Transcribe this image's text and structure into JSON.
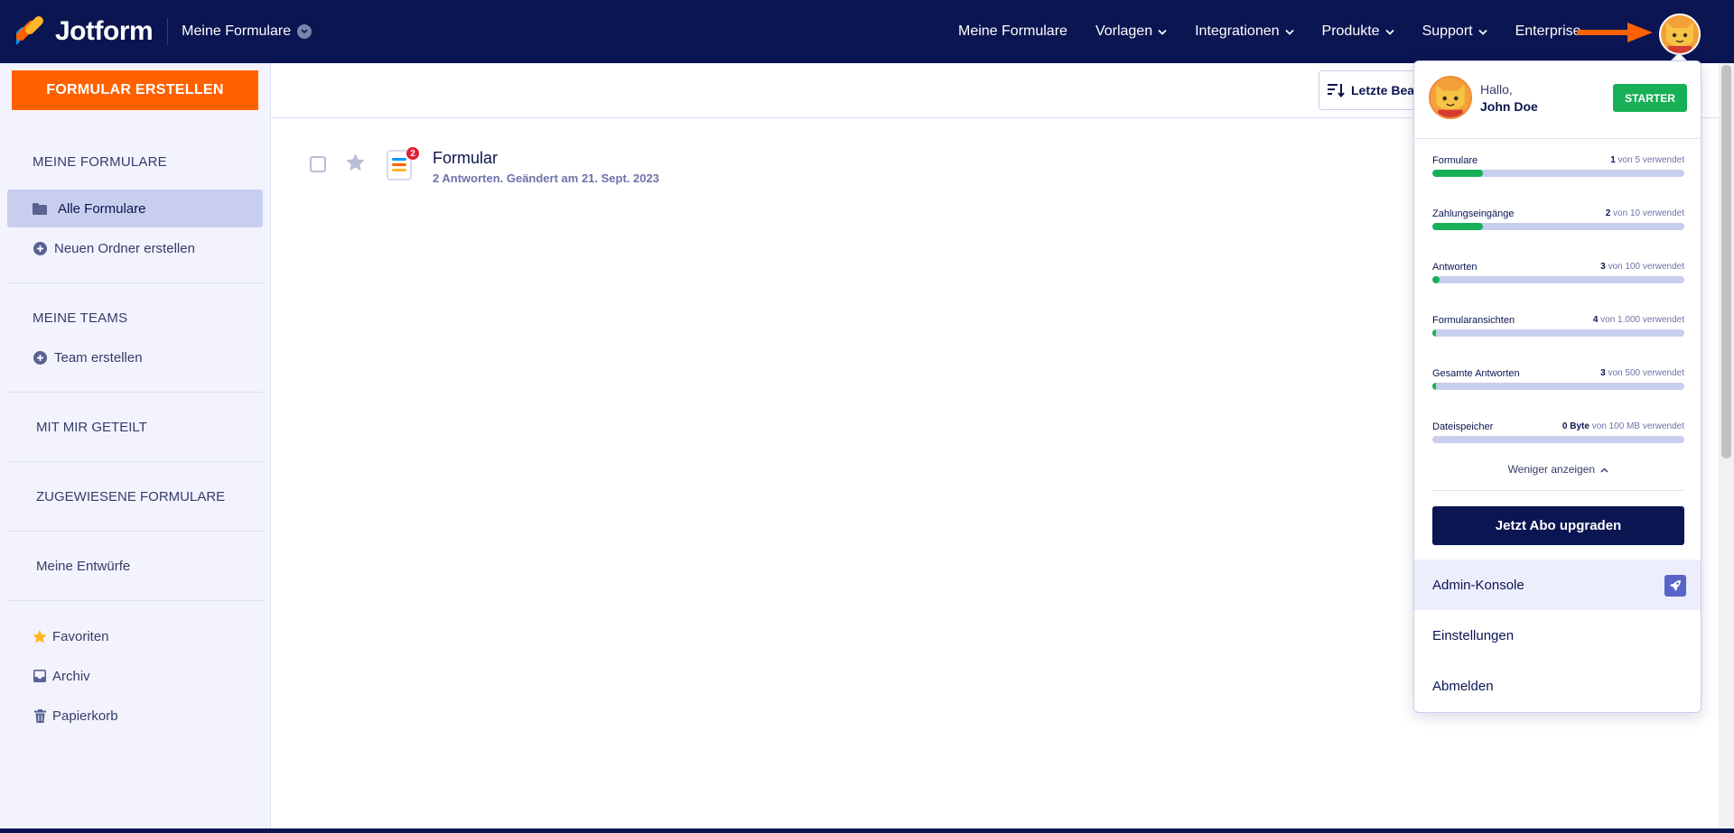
{
  "topbar": {
    "brand": "Jotform",
    "breadcrumb": "Meine Formulare",
    "nav": [
      {
        "label": "Meine Formulare",
        "has_menu": false
      },
      {
        "label": "Vorlagen",
        "has_menu": true
      },
      {
        "label": "Integrationen",
        "has_menu": true
      },
      {
        "label": "Produkte",
        "has_menu": true
      },
      {
        "label": "Support",
        "has_menu": true
      },
      {
        "label": "Enterprise",
        "has_menu": false
      }
    ],
    "arrow_color": "#ff6100"
  },
  "sidebar": {
    "create_button": "FORMULAR ERSTELLEN",
    "my_forms_heading": "MEINE FORMULARE",
    "all_forms": "Alle Formulare",
    "new_folder": "Neuen Ordner erstellen",
    "my_teams_heading": "MEINE TEAMS",
    "create_team": "Team erstellen",
    "shared_with_me": "MIT MIR GETEILT",
    "assigned_forms": "ZUGEWIESENE FORMULARE",
    "drafts": "Meine Entwürfe",
    "favorites": "Favoriten",
    "archive": "Archiv",
    "trash": "Papierkorb"
  },
  "toolbar": {
    "sort_label": "Letzte Bea"
  },
  "forms": [
    {
      "title": "Formular",
      "meta": "2 Antworten. Geändert am 21. Sept. 2023",
      "badge": "2"
    }
  ],
  "account": {
    "greeting": "Hallo,",
    "name": "John Doe",
    "plan": "STARTER",
    "usage": [
      {
        "label": "Formulare",
        "used": "1",
        "rest": "von 5 verwendet",
        "fraction": 0.2
      },
      {
        "label": "Zahlungseingänge",
        "used": "2",
        "rest": "von 10 verwendet",
        "fraction": 0.2
      },
      {
        "label": "Antworten",
        "used": "3",
        "rest": "von 100 verwendet",
        "fraction": 0.03
      },
      {
        "label": "Formularansichten",
        "used": "4",
        "rest": "von 1.000 verwendet",
        "fraction": 0.004
      },
      {
        "label": "Gesamte Antworten",
        "used": "3",
        "rest": "von 500 verwendet",
        "fraction": 0.006
      },
      {
        "label": "Dateispeicher",
        "used": "0 Byte",
        "rest": "von 100 MB verwendet",
        "fraction": 0
      }
    ],
    "show_less": "Weniger anzeigen",
    "upgrade": "Jetzt Abo upgraden",
    "admin_console": "Admin-Konsole",
    "settings": "Einstellungen",
    "logout": "Abmelden"
  },
  "colors": {
    "navy": "#0a1551",
    "orange": "#ff6100",
    "green": "#18b057",
    "sidebar_bg": "#f3f3fe",
    "active_item": "#c8ceed"
  }
}
